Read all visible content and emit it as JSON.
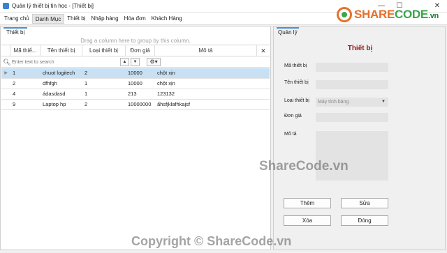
{
  "window": {
    "title": "Quản lý thiết bị tin học - [Thiết bị]",
    "min_glyph": "—",
    "max_glyph": "☐",
    "close_glyph": "✕"
  },
  "logo": {
    "text_share": "SHARE",
    "text_code": "CODE",
    "text_tld": ".vn"
  },
  "menu": [
    {
      "label": "Trang chủ"
    },
    {
      "label": "Danh Mục"
    },
    {
      "label": "Thiết bị"
    },
    {
      "label": "Nhập hàng"
    },
    {
      "label": "Hóa đơn"
    },
    {
      "label": "Khách Hàng"
    }
  ],
  "left": {
    "tab": "Thiết bị",
    "group_hint": "Drag a column here to group by this column.",
    "columns": [
      "Mã thiế...",
      "Tên thiết bị",
      "Loại thiết bị",
      "Đơn giá",
      "Mô tả"
    ],
    "close_glyph": "✕",
    "search_placeholder": "Enter text to search",
    "rows": [
      {
        "ma": "1",
        "ten": "chuot logitech",
        "loai": "2",
        "gia": "10000",
        "mota": "chột xịn"
      },
      {
        "ma": "2",
        "ten": "dfhfgh",
        "loai": "1",
        "gia": "10000",
        "mota": "chột xịn"
      },
      {
        "ma": "4",
        "ten": "ádasdasd",
        "loai": "1",
        "gia": "213",
        "mota": "123132"
      },
      {
        "ma": "9",
        "ten": "Laptop hp",
        "loai": "2",
        "gia": "10000000",
        "mota": "ấhsfjklafhkajsf"
      }
    ],
    "selected_index": 0
  },
  "right": {
    "tab": "Quản lý",
    "form_title": "Thiết bị",
    "labels": {
      "ma": "Mã thiết bị",
      "ten": "Tên thiết bị",
      "loai": "Loại thiết bị",
      "gia": "Đơn giá",
      "mota": "Mô tả"
    },
    "loai_selected": "Máy tính bảng",
    "buttons": {
      "them": "Thêm",
      "sua": "Sửa",
      "xoa": "Xóa",
      "dong": "Đóng"
    }
  },
  "watermarks": {
    "center": "ShareCode.vn",
    "bottom": "Copyright © ShareCode.vn"
  },
  "colors": {
    "accent_tab": "#4a90d9",
    "selected_row": "#c7e0f4",
    "form_title": "#8b1a1a",
    "logo_orange": "#e8702a",
    "logo_green": "#3aa64c"
  }
}
